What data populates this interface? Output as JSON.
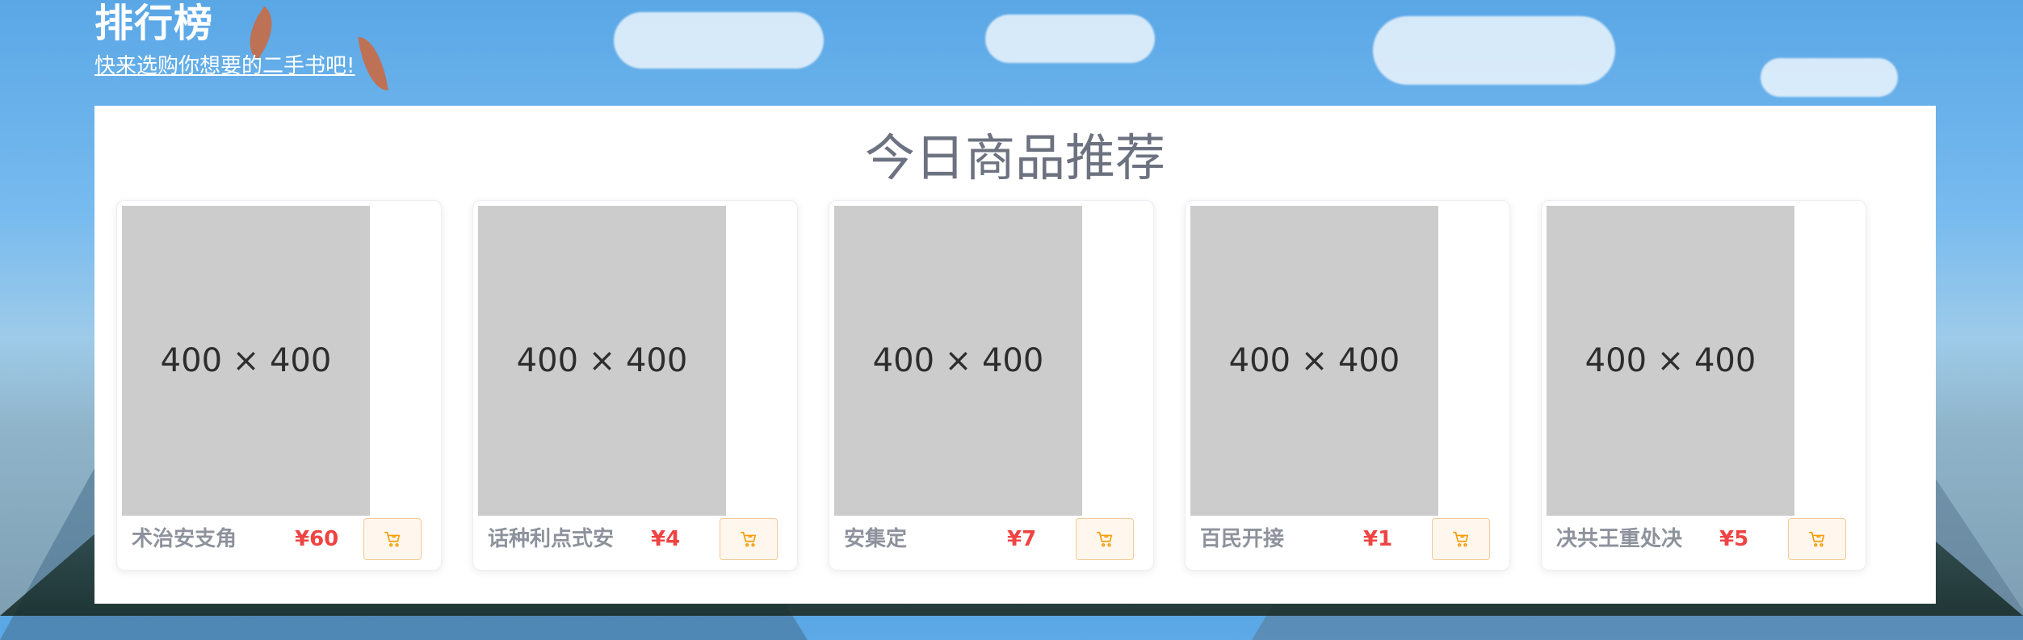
{
  "header": {
    "title": "排行榜",
    "subtitle": "快来选购你想要的二手书吧!"
  },
  "section": {
    "title": "今日商品推荐"
  },
  "products": [
    {
      "image_placeholder": "400 × 400",
      "name": "术治安支角",
      "price": "¥60",
      "cart_icon": "shopping-cart-icon"
    },
    {
      "image_placeholder": "400 × 400",
      "name": "话种利点式安",
      "price": "¥4",
      "cart_icon": "shopping-cart-icon"
    },
    {
      "image_placeholder": "400 × 400",
      "name": "安集定",
      "price": "¥7",
      "cart_icon": "shopping-cart-icon"
    },
    {
      "image_placeholder": "400 × 400",
      "name": "百民开接",
      "price": "¥1",
      "cart_icon": "shopping-cart-icon"
    },
    {
      "image_placeholder": "400 × 400",
      "name": "决共王重处决",
      "price": "¥5",
      "cart_icon": "shopping-cart-icon"
    }
  ],
  "colors": {
    "panel_background": "#ffffff",
    "title_gray": "#6c7280",
    "price_red": "#ef4444",
    "cart_border": "#f4c994",
    "cart_background": "#fff7ed",
    "image_placeholder": "#cccccc"
  }
}
